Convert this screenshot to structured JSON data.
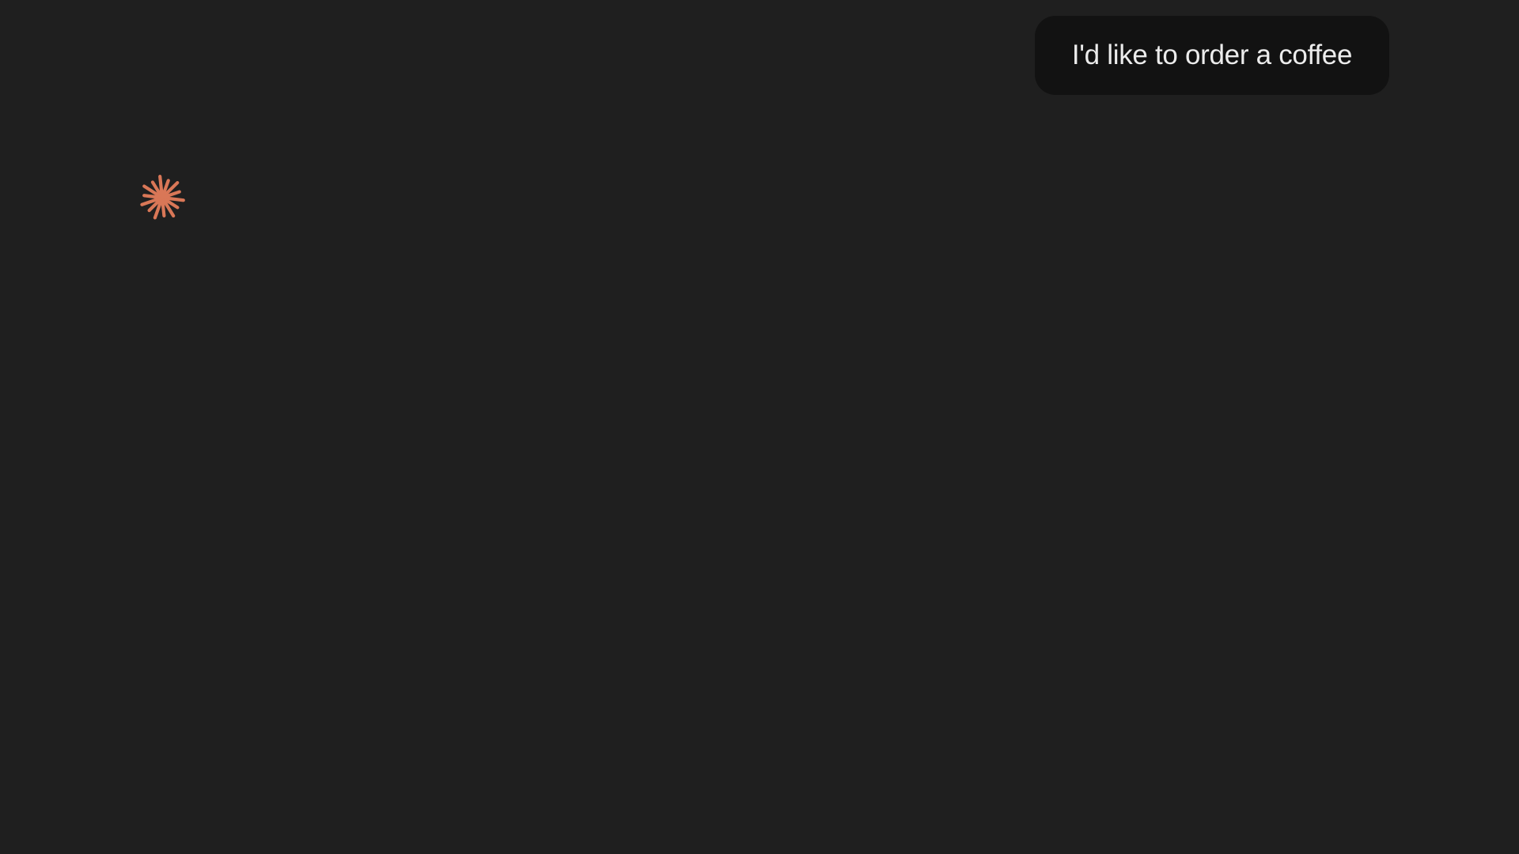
{
  "conversation": {
    "user_message": "I'd like to order a coffee",
    "assistant_state": "thinking-starburst-icon"
  },
  "colors": {
    "background": "#1f1f1f",
    "user_bubble": "#121212",
    "user_text": "#ececec",
    "assistant_accent": "#d97757"
  }
}
